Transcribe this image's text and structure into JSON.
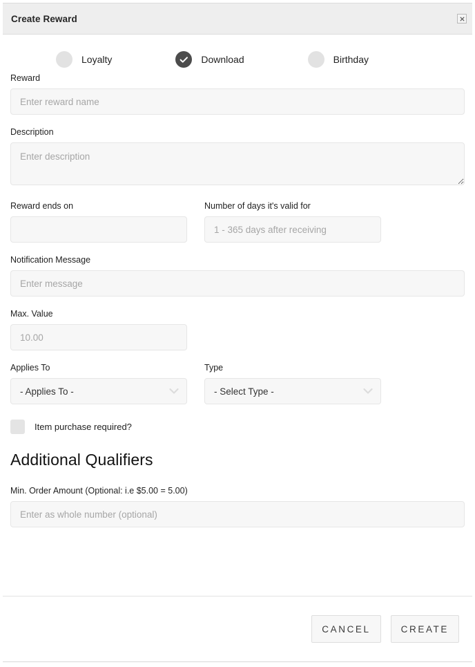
{
  "dialog": {
    "title": "Create Reward",
    "close_label": "×"
  },
  "reward_type": {
    "options": [
      {
        "label": "Loyalty",
        "selected": false
      },
      {
        "label": "Download",
        "selected": true
      },
      {
        "label": "Birthday",
        "selected": false
      }
    ]
  },
  "form": {
    "reward": {
      "label": "Reward",
      "placeholder": "Enter reward name",
      "value": ""
    },
    "description": {
      "label": "Description",
      "placeholder": "Enter description",
      "value": ""
    },
    "reward_ends_on": {
      "label": "Reward ends on",
      "placeholder": "",
      "value": ""
    },
    "days_valid": {
      "label": "Number of days it's valid for",
      "placeholder": "1 - 365 days after receiving",
      "value": ""
    },
    "notification_message": {
      "label": "Notification Message",
      "placeholder": "Enter message",
      "value": ""
    },
    "max_value": {
      "label": "Max. Value",
      "placeholder": "10.00",
      "value": ""
    },
    "applies_to": {
      "label": "Applies To",
      "selected": "- Applies To -"
    },
    "type": {
      "label": "Type",
      "selected": "- Select Type -"
    },
    "item_purchase_required": {
      "label": "Item purchase required?",
      "checked": false
    }
  },
  "additional_qualifiers": {
    "heading": "Additional Qualifiers",
    "min_order_amount": {
      "label": "Min. Order Amount (Optional: i.e $5.00 = 5.00)",
      "placeholder": "Enter as whole number (optional)",
      "value": ""
    }
  },
  "footer": {
    "cancel_label": "CANCEL",
    "create_label": "CREATE"
  },
  "colors": {
    "header_bg": "#eeeeee",
    "field_bg": "#f7f7f7",
    "radio_selected": "#4c4c4c",
    "radio_unselected": "#e2e2e2"
  }
}
